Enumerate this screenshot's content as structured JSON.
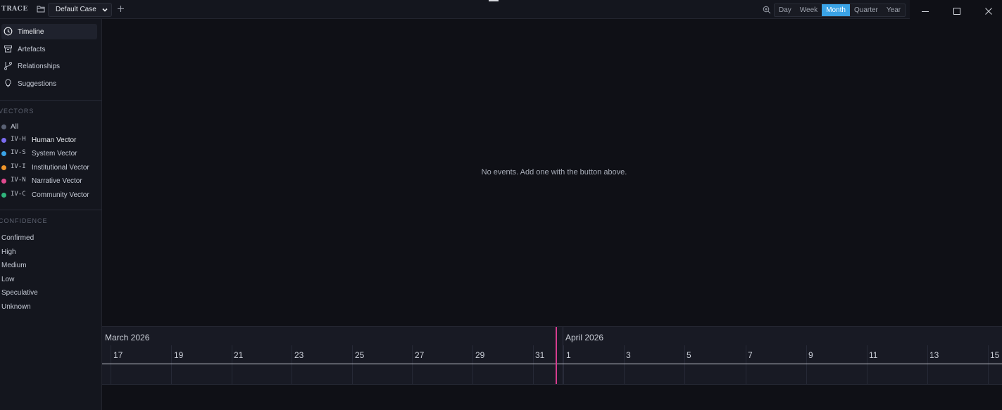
{
  "app": {
    "logo": "TRACE"
  },
  "toolbar": {
    "case_name": "Default Case",
    "scales": [
      "Day",
      "Week",
      "Month",
      "Quarter",
      "Year"
    ],
    "active_scale": "Month"
  },
  "icons": {
    "folder": "folder-open-icon",
    "chevron": "chevron-down-icon",
    "add": "plus-icon",
    "zoom": "zoom-in-icon",
    "minimize": "minimize-icon",
    "maximize": "maximize-icon",
    "close": "close-icon"
  },
  "sidebar": {
    "nav": [
      {
        "label": "Timeline",
        "icon": "clock-icon",
        "active": true
      },
      {
        "label": "Artefacts",
        "icon": "archive-icon",
        "active": false
      },
      {
        "label": "Relationships",
        "icon": "git-branch-icon",
        "active": false
      },
      {
        "label": "Suggestions",
        "icon": "lightbulb-icon",
        "active": false
      }
    ],
    "vectors_title": "VECTORS",
    "vectors": [
      {
        "label": "All",
        "code": "",
        "color": "#5a6275"
      },
      {
        "label": "Human Vector",
        "code": "IV-H",
        "color": "#7b6cf0"
      },
      {
        "label": "System Vector",
        "code": "IV-S",
        "color": "#3aa3e6"
      },
      {
        "label": "Institutional Vector",
        "code": "IV-I",
        "color": "#f0962a"
      },
      {
        "label": "Narrative Vector",
        "code": "IV-N",
        "color": "#e04a8f"
      },
      {
        "label": "Community Vector",
        "code": "IV-C",
        "color": "#2fb57c"
      }
    ],
    "confidence_title": "CONFIDENCE",
    "confidence": [
      "Confirmed",
      "High",
      "Medium",
      "Low",
      "Speculative",
      "Unknown"
    ]
  },
  "main": {
    "empty_message": "No events. Add one with the button above."
  },
  "timeline": {
    "months": [
      "March 2026",
      "April 2026"
    ],
    "march_ticks": [
      "17",
      "19",
      "21",
      "23",
      "25",
      "27",
      "29",
      "31"
    ],
    "april_ticks": [
      "1",
      "3",
      "5",
      "7",
      "9",
      "11",
      "13",
      "15"
    ]
  }
}
